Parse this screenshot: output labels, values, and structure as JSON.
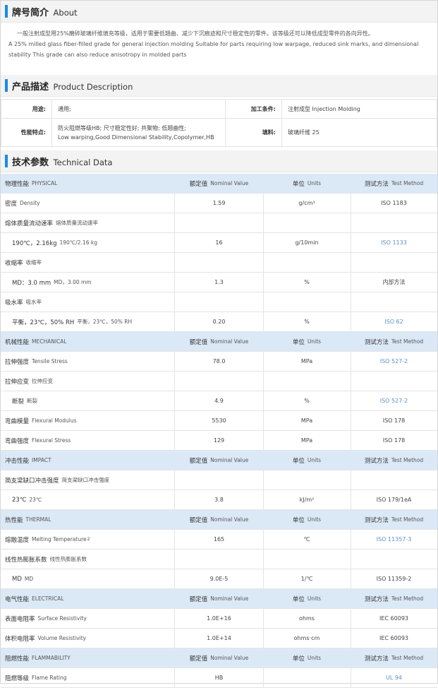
{
  "about": {
    "title_zh": "牌号简介",
    "title_en": "About",
    "text_zh": "一般注射成型用25%磨碎玻璃纤维填充等级，适用于需要低翘曲、减少下沉痕迹和尺寸稳定性的零件。该等级还可以降低成型零件的各向异性。",
    "text_en": "A 25% milled glass fiber-filled grade for general injection molding Suitable for parts requiring low warpage, reduced sink marks, and dimensional stability This grade can also reduce anisotropy in molded parts"
  },
  "product": {
    "title_zh": "产品描述",
    "title_en": "Product Description",
    "use_label": "用途:",
    "use_value": "通用;",
    "process_label": "加工条件:",
    "process_value": "注射成型  Injection Molding",
    "feature_label": "性能特点:",
    "feature_value_zh": "防火阻燃等级HB; 尺寸稳定性好; 共聚物; 低翘曲性;",
    "feature_value_en": "Low warping,Good Dimensional Stability,Copolymer,HB",
    "filler_label": "填料:",
    "filler_value": "玻璃纤维  25"
  },
  "tech": {
    "title_zh": "技术参数",
    "title_en": "Technical Data",
    "rows": [
      {
        "type": "hdr",
        "zh": "物理性能",
        "en": "PHYSICAL",
        "v_zh": "额定值",
        "v_en": "Nominal Value",
        "u_zh": "单位",
        "u_en": "Units",
        "m_zh": "测试方法",
        "m_en": "Test Method"
      },
      {
        "type": "data",
        "zh": "密度",
        "en": "Density",
        "value": "1.59",
        "unit": "g/cm³",
        "method": "ISO 1183",
        "link": false
      },
      {
        "type": "data",
        "zh": "熔体质量流动速率",
        "en": "熔体质量流动速率",
        "value": "",
        "unit": "",
        "method": "",
        "link": false
      },
      {
        "type": "sub",
        "zh": "190℃，2.16kg",
        "en": "190℃/2.16 kg",
        "value": "16",
        "unit": "g/10min",
        "method": "ISO 1133",
        "link": true
      },
      {
        "type": "data",
        "zh": "收缩率",
        "en": "收缩率",
        "value": "",
        "unit": "",
        "method": "",
        "link": false
      },
      {
        "type": "sub",
        "zh": "MD：3.0 mm",
        "en": "MD，3.00 mm",
        "value": "1.3",
        "unit": "%",
        "method": "内部方法",
        "link": false
      },
      {
        "type": "data",
        "zh": "吸水率",
        "en": "吸水率",
        "value": "",
        "unit": "",
        "method": "",
        "link": false
      },
      {
        "type": "sub",
        "zh": "平衡，23℃，50% RH",
        "en": "平衡，23℃，50% RH",
        "value": "0.20",
        "unit": "%",
        "method": "ISO 62",
        "link": true
      },
      {
        "type": "hdr",
        "zh": "机械性能",
        "en": "MECHANICAL",
        "v_zh": "额定值",
        "v_en": "Nominal Value",
        "u_zh": "单位",
        "u_en": "Units",
        "m_zh": "测试方法",
        "m_en": "Test Method"
      },
      {
        "type": "data",
        "zh": "拉伸强度",
        "en": "Tensile Stress",
        "value": "78.0",
        "unit": "MPa",
        "method": "ISO 527-2",
        "link": true
      },
      {
        "type": "data",
        "zh": "拉伸应变",
        "en": "拉伸应变",
        "value": "",
        "unit": "",
        "method": "",
        "link": false
      },
      {
        "type": "sub",
        "zh": "断裂",
        "en": "断裂",
        "value": "4.9",
        "unit": "%",
        "method": "ISO 527-2",
        "link": true
      },
      {
        "type": "data",
        "zh": "弯曲模量",
        "en": "Flexural Modulus",
        "value": "5530",
        "unit": "MPa",
        "method": "ISO 178",
        "link": false
      },
      {
        "type": "data",
        "zh": "弯曲强度",
        "en": "Flexural Stress",
        "value": "129",
        "unit": "MPa",
        "method": "ISO 178",
        "link": false
      },
      {
        "type": "hdr",
        "zh": "冲击性能",
        "en": "IMPACT",
        "v_zh": "额定值",
        "v_en": "Nominal Value",
        "u_zh": "单位",
        "u_en": "Units",
        "m_zh": "测试方法",
        "m_en": "Test Method"
      },
      {
        "type": "data",
        "zh": "简支梁缺口冲击强度",
        "en": "简支梁缺口冲击强度",
        "value": "",
        "unit": "",
        "method": "",
        "link": false
      },
      {
        "type": "sub",
        "zh": "23℃",
        "en": "23℃",
        "value": "3.8",
        "unit": "kJ/m²",
        "method": "ISO 179/1eA",
        "link": false
      },
      {
        "type": "hdr",
        "zh": "热性能",
        "en": "THERMAL",
        "v_zh": "额定值",
        "v_en": "Nominal Value",
        "u_zh": "单位",
        "u_en": "Units",
        "m_zh": "测试方法",
        "m_en": "Test Method"
      },
      {
        "type": "data",
        "zh": "熔融温度",
        "en": "Melting Temperature",
        "sup": "2",
        "value": "165",
        "unit": "℃",
        "method": "ISO 11357-3",
        "link": true
      },
      {
        "type": "data",
        "zh": "线性热膨胀系数",
        "en": "线性热膨胀系数",
        "value": "",
        "unit": "",
        "method": "",
        "link": false
      },
      {
        "type": "sub",
        "zh": "MD",
        "en": "MD",
        "value": "9.0E-5",
        "unit": "1/℃",
        "method": "ISO 11359-2",
        "link": false
      },
      {
        "type": "hdr",
        "zh": "电气性能",
        "en": "ELECTRICAL",
        "v_zh": "额定值",
        "v_en": "Nominal Value",
        "u_zh": "单位",
        "u_en": "Units",
        "m_zh": "测试方法",
        "m_en": "Test Method"
      },
      {
        "type": "data",
        "zh": "表面电阻率",
        "en": "Surface Resistivity",
        "value": "1.0E+16",
        "unit": "ohms",
        "method": "IEC 60093",
        "link": false
      },
      {
        "type": "data",
        "zh": "体积电阻率",
        "en": "Volume Resistivity",
        "value": "1.0E+14",
        "unit": "ohms·cm",
        "method": "IEC 60093",
        "link": false
      },
      {
        "type": "hdr",
        "zh": "阻燃性能",
        "en": "FLAMMABILITY",
        "v_zh": "额定值",
        "v_en": "Nominal Value",
        "u_zh": "单位",
        "u_en": "Units",
        "m_zh": "测试方法",
        "m_en": "Test Method"
      },
      {
        "type": "data",
        "zh": "阻燃等级",
        "en": "Flame Rating",
        "value": "HB",
        "unit": "",
        "method": "UL 94",
        "link": true
      }
    ]
  },
  "colors": {
    "accent": "#1a8be0",
    "header_bg": "#dbe9f7",
    "link": "#5b8fc9"
  }
}
